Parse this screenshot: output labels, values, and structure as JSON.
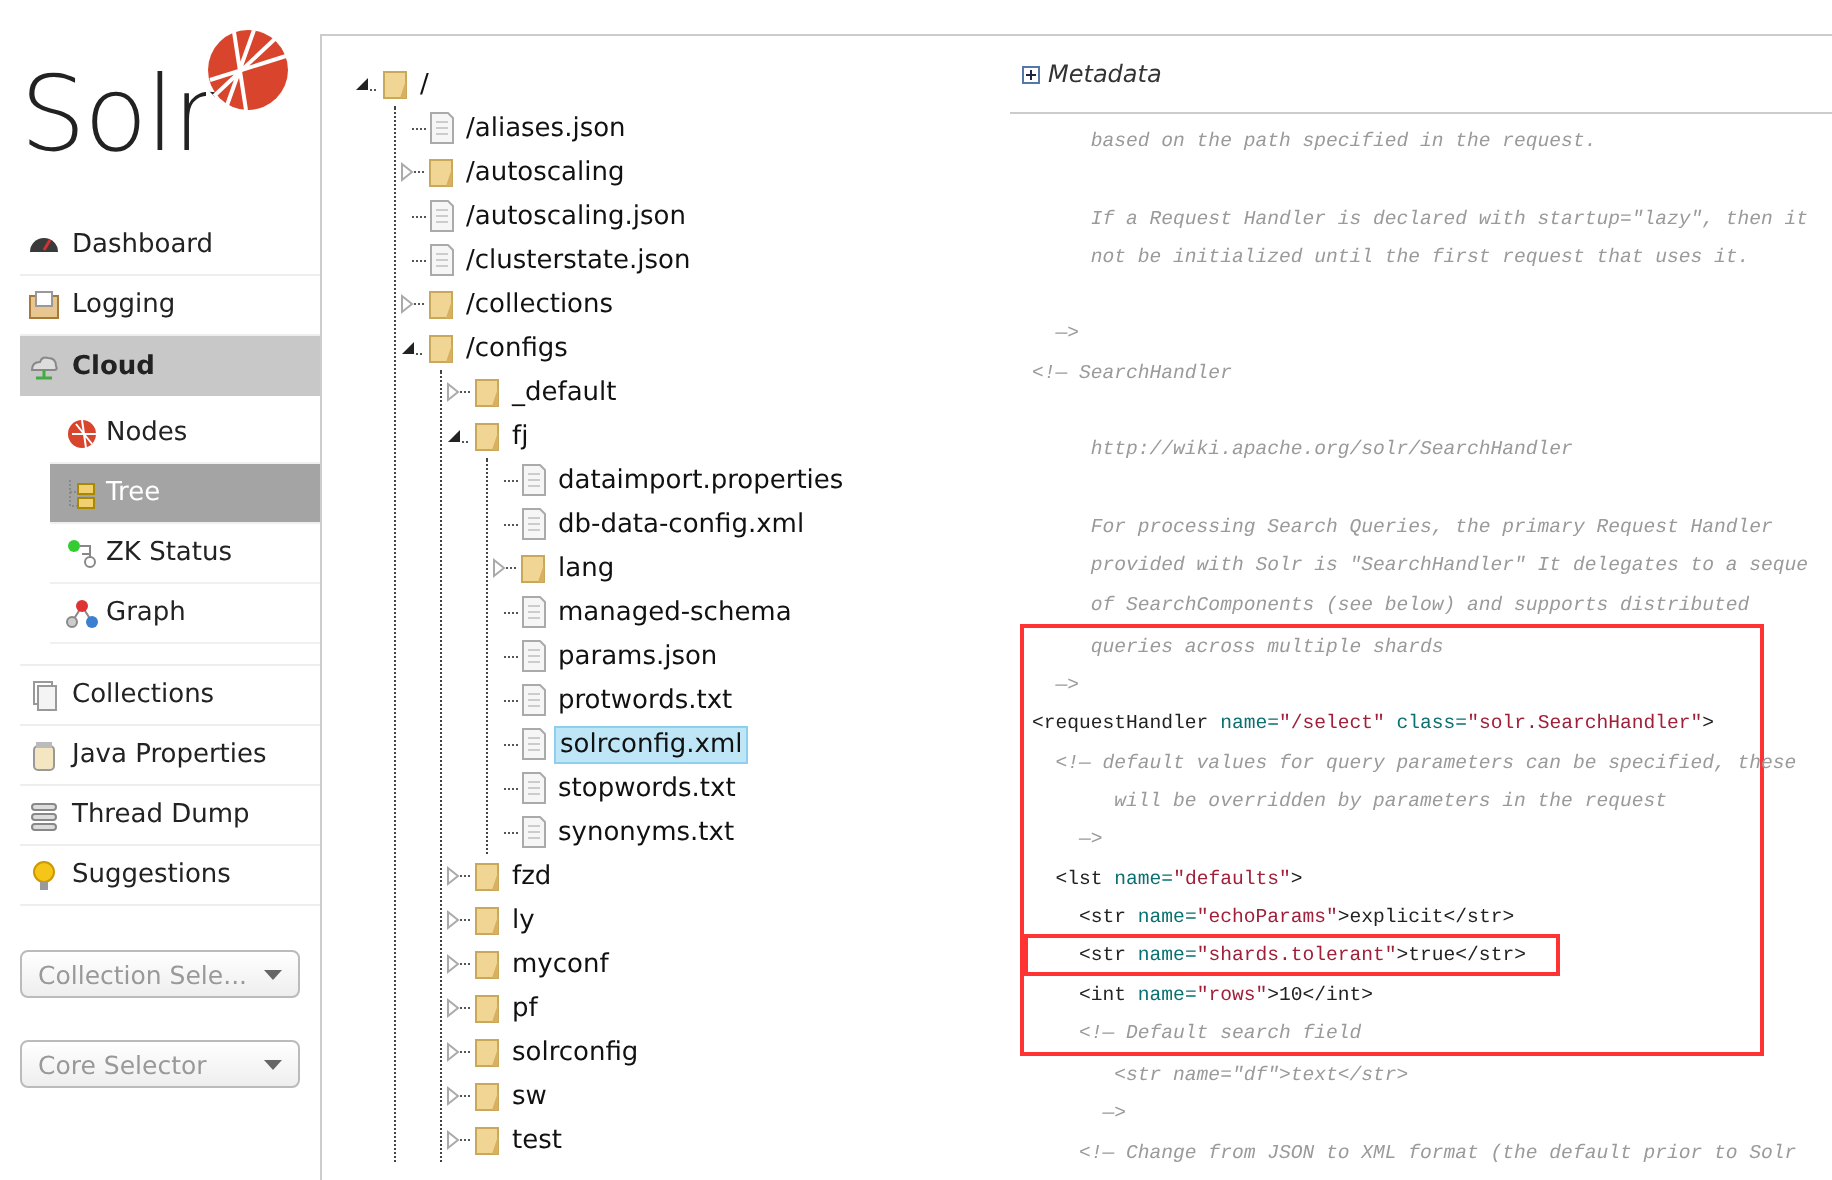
{
  "logo": {
    "text": "Solr"
  },
  "nav": [
    {
      "label": "Dashboard",
      "selected": false
    },
    {
      "label": "Logging",
      "selected": false
    },
    {
      "label": "Cloud",
      "selected": true,
      "children": [
        {
          "label": "Nodes",
          "selected": false
        },
        {
          "label": "Tree",
          "selected": true
        },
        {
          "label": "ZK Status",
          "selected": false
        },
        {
          "label": "Graph",
          "selected": false
        }
      ]
    },
    {
      "label": "Collections",
      "selected": false
    },
    {
      "label": "Java Properties",
      "selected": false
    },
    {
      "label": "Thread Dump",
      "selected": false
    },
    {
      "label": "Suggestions",
      "selected": false
    }
  ],
  "selectors": [
    {
      "placeholder": "Collection Sele..."
    },
    {
      "placeholder": "Core Selector"
    }
  ],
  "tree": [
    {
      "label": "/",
      "kind": "folder",
      "expanded": true,
      "selected": false,
      "children": [
        {
          "label": "/aliases.json",
          "kind": "file",
          "selected": false
        },
        {
          "label": "/autoscaling",
          "kind": "folder",
          "expanded": false,
          "selected": false
        },
        {
          "label": "/autoscaling.json",
          "kind": "file",
          "selected": false
        },
        {
          "label": "/clusterstate.json",
          "kind": "file",
          "selected": false
        },
        {
          "label": "/collections",
          "kind": "folder",
          "expanded": false,
          "selected": false
        },
        {
          "label": "/configs",
          "kind": "folder",
          "expanded": true,
          "selected": false,
          "children": [
            {
              "label": "_default",
              "kind": "folder",
              "expanded": false,
              "selected": false
            },
            {
              "label": "fj",
              "kind": "folder",
              "expanded": true,
              "selected": false,
              "children": [
                {
                  "label": "dataimport.properties",
                  "kind": "file",
                  "selected": false
                },
                {
                  "label": "db-data-config.xml",
                  "kind": "file",
                  "selected": false
                },
                {
                  "label": "lang",
                  "kind": "folder",
                  "expanded": false,
                  "selected": false
                },
                {
                  "label": "managed-schema",
                  "kind": "file",
                  "selected": false
                },
                {
                  "label": "params.json",
                  "kind": "file",
                  "selected": false
                },
                {
                  "label": "protwords.txt",
                  "kind": "file",
                  "selected": false
                },
                {
                  "label": "solrconfig.xml",
                  "kind": "file",
                  "selected": true
                },
                {
                  "label": "stopwords.txt",
                  "kind": "file",
                  "selected": false
                },
                {
                  "label": "synonyms.txt",
                  "kind": "file",
                  "selected": false
                }
              ]
            },
            {
              "label": "fzd",
              "kind": "folder",
              "expanded": false,
              "selected": false
            },
            {
              "label": "ly",
              "kind": "folder",
              "expanded": false,
              "selected": false
            },
            {
              "label": "myconf",
              "kind": "folder",
              "expanded": false,
              "selected": false
            },
            {
              "label": "pf",
              "kind": "folder",
              "expanded": false,
              "selected": false
            },
            {
              "label": "solrconfig",
              "kind": "folder",
              "expanded": false,
              "selected": false
            },
            {
              "label": "sw",
              "kind": "folder",
              "expanded": false,
              "selected": false
            },
            {
              "label": "test",
              "kind": "folder",
              "expanded": false,
              "selected": false
            }
          ]
        }
      ]
    }
  ],
  "metadata": {
    "title": "Metadata",
    "expanded": false
  },
  "code": {
    "before": [
      {
        "kind": "comment",
        "text": "     based on the path specified in the request."
      },
      {
        "kind": "blank"
      },
      {
        "kind": "comment",
        "text": "     If a Request Handler is declared with startup=\"lazy\", then it"
      },
      {
        "kind": "comment",
        "text": "     not be initialized until the first request that uses it."
      },
      {
        "kind": "blank"
      },
      {
        "kind": "comment",
        "text": "  —>"
      },
      {
        "kind": "comment",
        "text": "<!— SearchHandler"
      },
      {
        "kind": "blank"
      },
      {
        "kind": "comment",
        "text": "     http://wiki.apache.org/solr/SearchHandler"
      },
      {
        "kind": "blank"
      },
      {
        "kind": "comment",
        "text": "     For processing Search Queries, the primary Request Handler"
      },
      {
        "kind": "comment",
        "text": "     provided with Solr is \"SearchHandler\" It delegates to a seque"
      },
      {
        "kind": "comment",
        "text": "     of SearchComponents (see below) and supports distributed"
      }
    ],
    "highlighted": [
      {
        "kind": "comment",
        "text": "     queries across multiple shards"
      },
      {
        "kind": "comment",
        "text": "  —>"
      },
      {
        "kind": "tag",
        "tokens": [
          {
            "kind": "tag",
            "text": "<requestHandler "
          },
          {
            "kind": "attr",
            "text": "name="
          },
          {
            "kind": "value",
            "text": "\"/select\""
          },
          {
            "kind": "attr",
            "text": " class="
          },
          {
            "kind": "value",
            "text": "\"solr.SearchHandler\""
          },
          {
            "kind": "tag",
            "text": ">"
          }
        ]
      },
      {
        "kind": "comment",
        "text": "  <!— default values for query parameters can be specified, these"
      },
      {
        "kind": "comment",
        "text": "       will be overridden by parameters in the request"
      },
      {
        "kind": "comment",
        "text": "    —>"
      },
      {
        "kind": "tag",
        "tokens": [
          {
            "kind": "tag",
            "text": "  <lst "
          },
          {
            "kind": "attr",
            "text": "name="
          },
          {
            "kind": "value",
            "text": "\"defaults\""
          },
          {
            "kind": "tag",
            "text": ">"
          }
        ]
      },
      {
        "kind": "tag",
        "tokens": [
          {
            "kind": "tag",
            "text": "    <str "
          },
          {
            "kind": "attr",
            "text": "name="
          },
          {
            "kind": "value",
            "text": "\"echoParams\""
          },
          {
            "kind": "tag",
            "text": ">explicit</str>"
          }
        ]
      },
      {
        "kind": "tag",
        "boxed": true,
        "tokens": [
          {
            "kind": "tag",
            "text": "    <str "
          },
          {
            "kind": "attr",
            "text": "name="
          },
          {
            "kind": "value",
            "text": "\"shards.tolerant\""
          },
          {
            "kind": "tag",
            "text": ">true</str>"
          }
        ]
      },
      {
        "kind": "tag",
        "tokens": [
          {
            "kind": "tag",
            "text": "    <int "
          },
          {
            "kind": "attr",
            "text": "name="
          },
          {
            "kind": "value",
            "text": "\"rows\""
          },
          {
            "kind": "tag",
            "text": ">10</int>"
          }
        ]
      },
      {
        "kind": "comment",
        "text": "    <!— Default search field"
      }
    ],
    "after": [
      {
        "kind": "comment",
        "text": "       <str name=\"df\">text</str>"
      },
      {
        "kind": "comment",
        "text": "      —>"
      },
      {
        "kind": "comment",
        "text": "    <!— Change from JSON to XML format (the default prior to Solr"
      }
    ]
  }
}
